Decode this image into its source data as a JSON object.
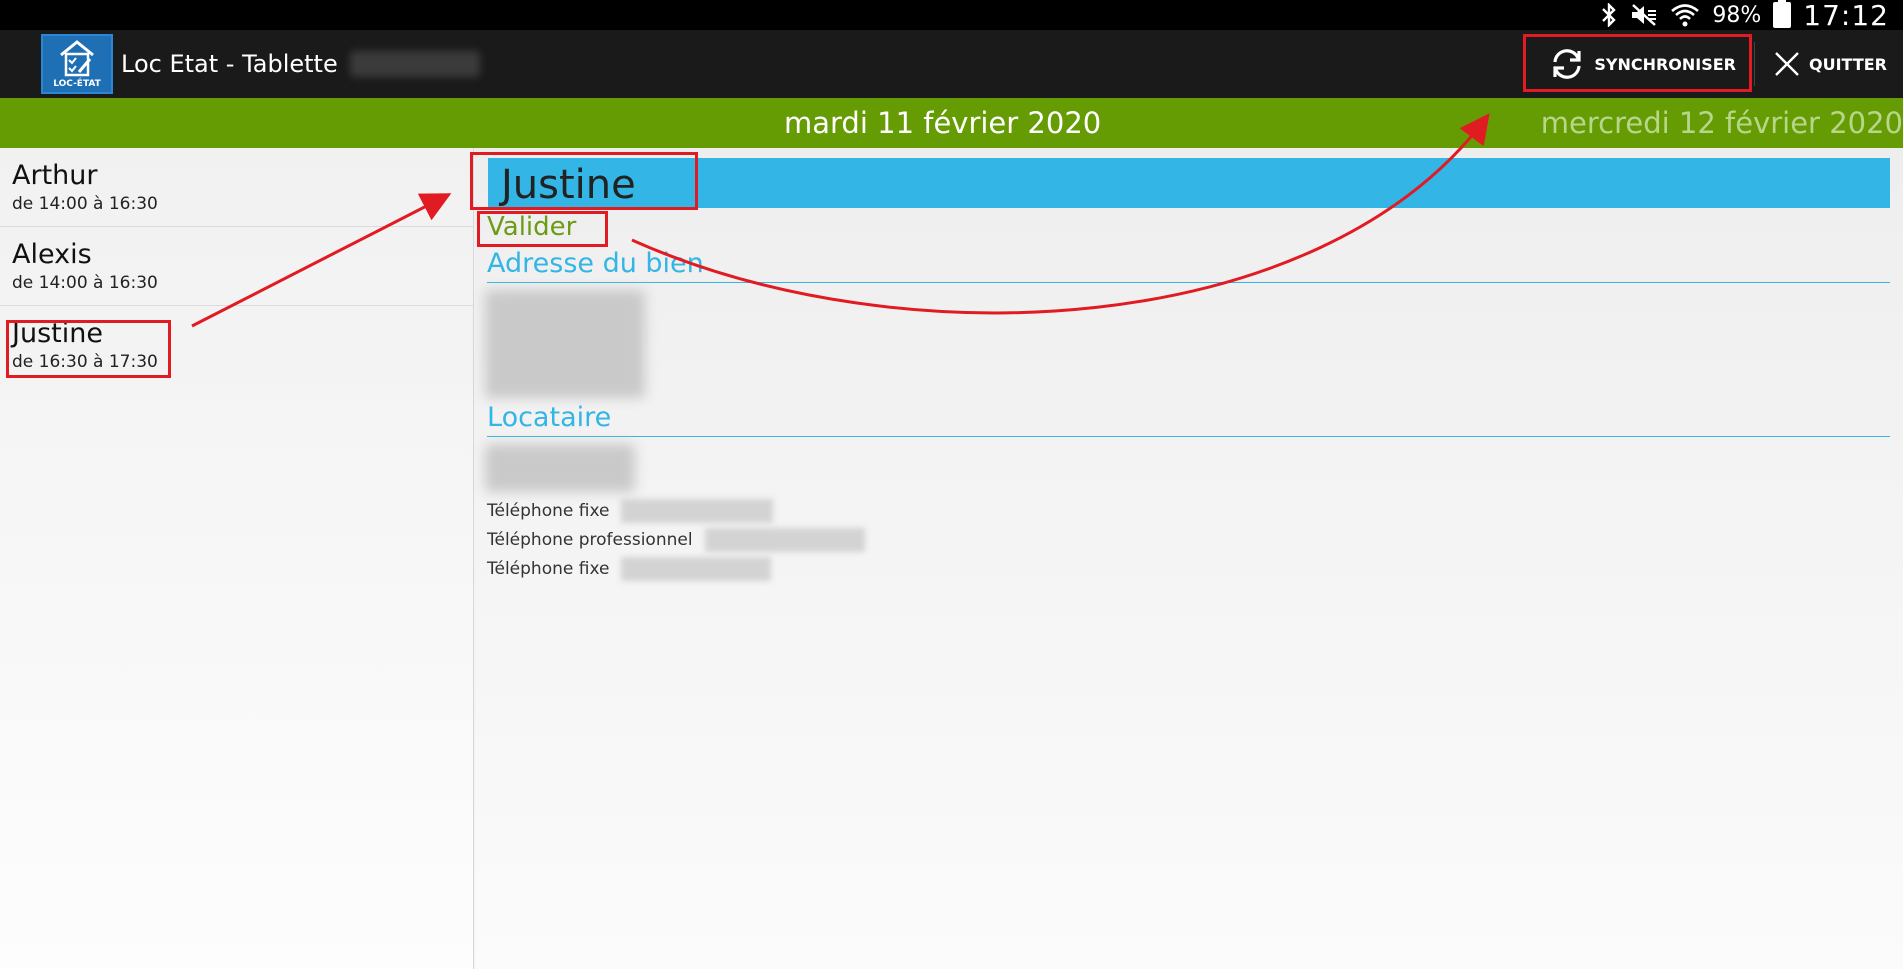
{
  "status_bar": {
    "battery": "98%",
    "time": "17:12",
    "icons": [
      "bluetooth-icon",
      "silent-icon",
      "wifi-icon",
      "battery-icon"
    ]
  },
  "action_bar": {
    "app_title": "Loc Etat - Tablette",
    "logo_caption": "LOC-ÉTAT",
    "sync_label": "SYNCHRONISER",
    "quit_label": "QUITTER"
  },
  "dates": {
    "current": "mardi 11 février 2020",
    "next": "mercredi 12 février 2020"
  },
  "appointments": [
    {
      "name": "Arthur",
      "time": "de 14:00 à 16:30"
    },
    {
      "name": "Alexis",
      "time": "de 14:00 à 16:30"
    },
    {
      "name": "Justine",
      "time": "de 16:30 à 17:30"
    }
  ],
  "detail": {
    "name": "Justine",
    "validate_label": "Valider",
    "address_title": "Adresse du bien",
    "tenant_title": "Locataire",
    "phones": [
      {
        "label": "Téléphone fixe"
      },
      {
        "label": "Téléphone professionnel"
      },
      {
        "label": "Téléphone fixe"
      }
    ]
  },
  "colors": {
    "accent_blue": "#33b5e5",
    "date_green": "#669c03",
    "validate_green": "#6c9b15",
    "annotation_red": "#e11b22"
  }
}
